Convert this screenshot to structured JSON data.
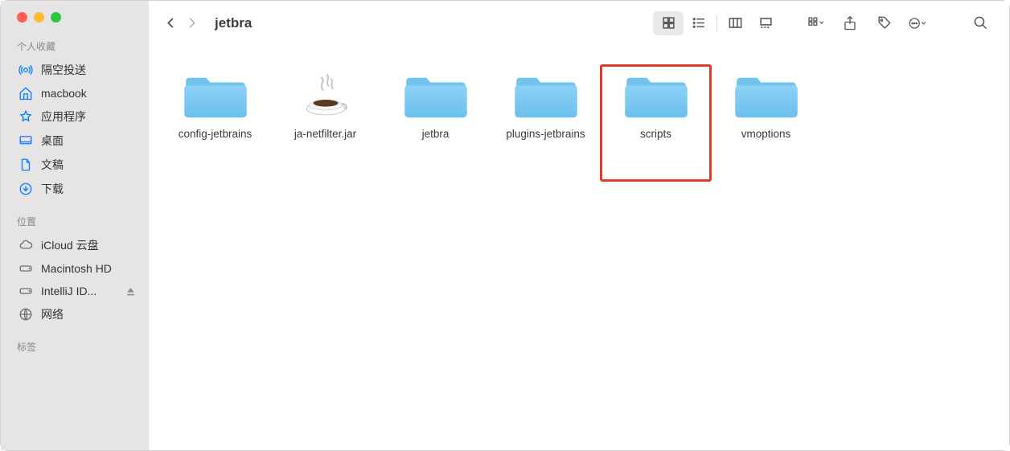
{
  "window": {
    "title": "jetbra"
  },
  "sidebar": {
    "sections": [
      {
        "title": "个人收藏",
        "items": [
          {
            "label": "隔空投送",
            "icon": "airdrop"
          },
          {
            "label": "macbook",
            "icon": "house"
          },
          {
            "label": "应用程序",
            "icon": "appstore"
          },
          {
            "label": "桌面",
            "icon": "desktop"
          },
          {
            "label": "文稿",
            "icon": "document"
          },
          {
            "label": "下载",
            "icon": "download"
          }
        ]
      },
      {
        "title": "位置",
        "items": [
          {
            "label": "iCloud 云盘",
            "icon": "cloud",
            "gray": true
          },
          {
            "label": "Macintosh HD",
            "icon": "disk",
            "gray": true
          },
          {
            "label": "IntelliJ ID...",
            "icon": "disk",
            "gray": true,
            "eject": true
          },
          {
            "label": "网络",
            "icon": "network",
            "gray": true
          }
        ]
      },
      {
        "title": "标签",
        "items": []
      }
    ]
  },
  "items": [
    {
      "name": "config-jetbrains",
      "type": "folder",
      "highlighted": false
    },
    {
      "name": "ja-netfilter.jar",
      "type": "jar",
      "highlighted": false
    },
    {
      "name": "jetbra",
      "type": "folder",
      "highlighted": false
    },
    {
      "name": "plugins-jetbrains",
      "type": "folder",
      "highlighted": false
    },
    {
      "name": "scripts",
      "type": "folder",
      "highlighted": true
    },
    {
      "name": "vmoptions",
      "type": "folder",
      "highlighted": false
    }
  ]
}
